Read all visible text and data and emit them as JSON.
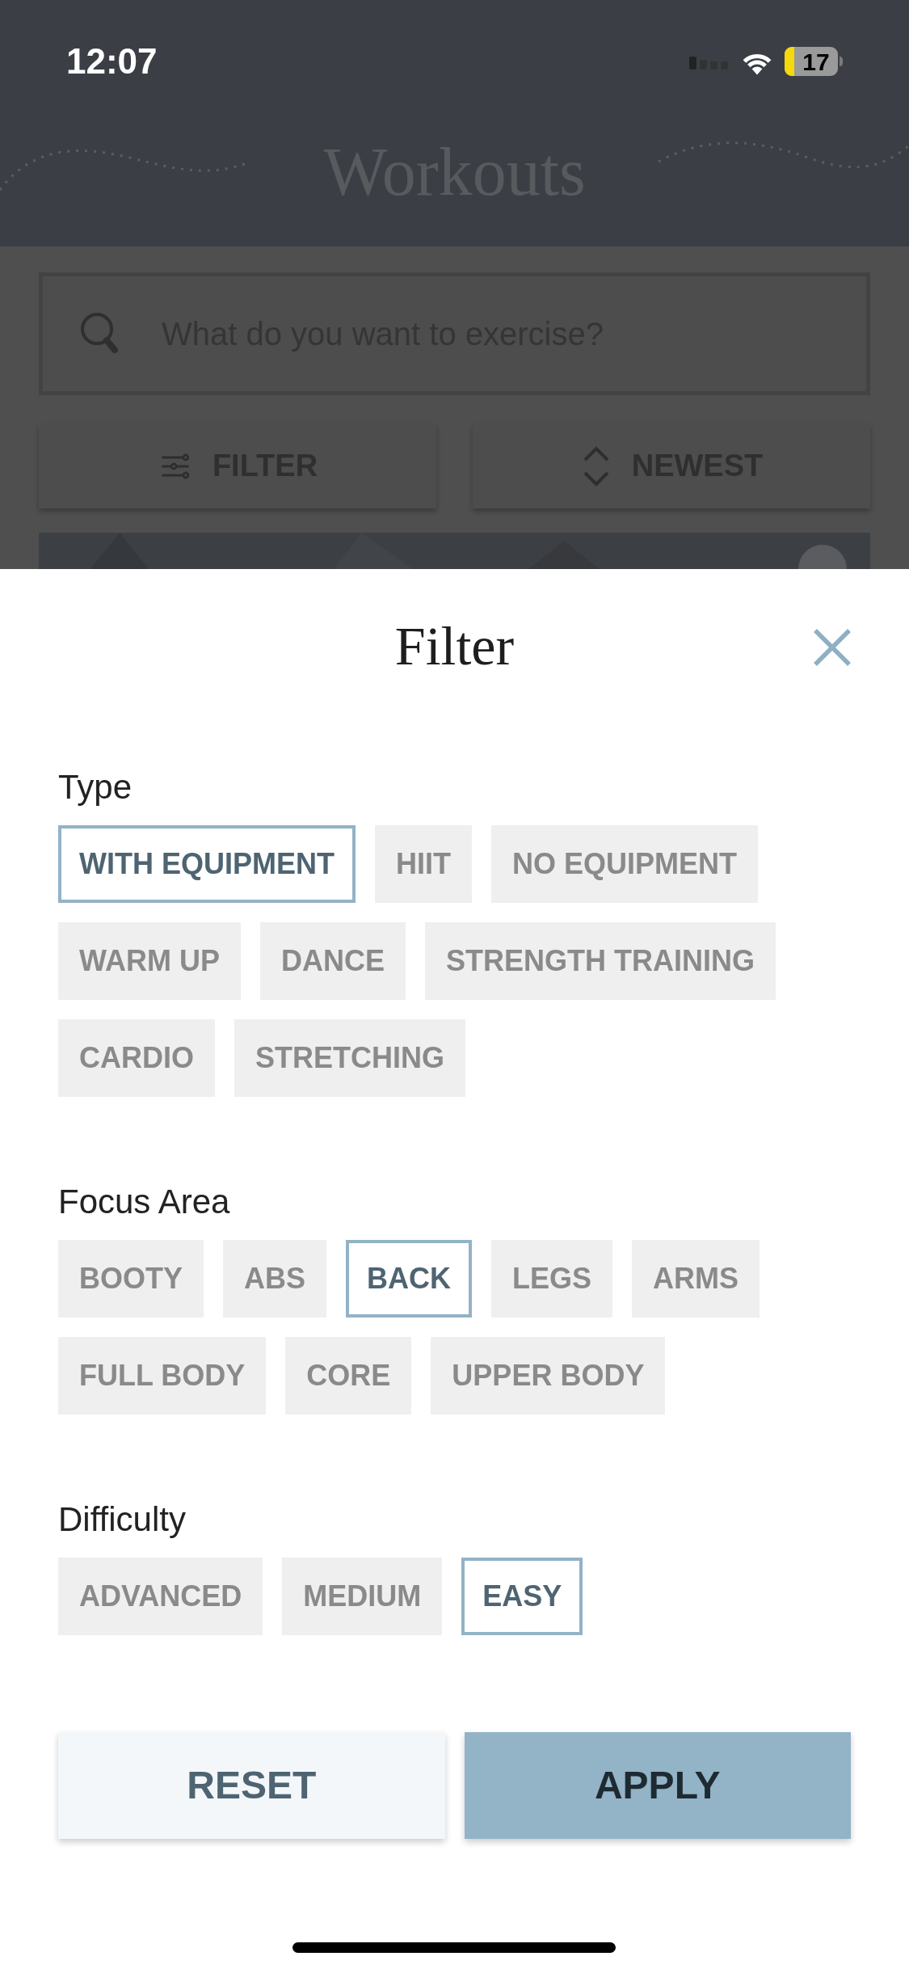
{
  "status_bar": {
    "time": "12:07",
    "battery": "17"
  },
  "header": {
    "title": "Workouts"
  },
  "search": {
    "placeholder": "What do you want to exercise?"
  },
  "toolbar": [
    {
      "label": "FILTER",
      "kind": "filter"
    },
    {
      "label": "NEWEST",
      "kind": "sort"
    }
  ],
  "sheet": {
    "title": "Filter",
    "sections": [
      {
        "label": "Type",
        "options": [
          {
            "label": "WITH EQUIPMENT",
            "selected": true
          },
          {
            "label": "HIIT",
            "selected": false
          },
          {
            "label": "NO EQUIPMENT",
            "selected": false
          },
          {
            "label": "WARM UP",
            "selected": false
          },
          {
            "label": "DANCE",
            "selected": false
          },
          {
            "label": "STRENGTH TRAINING",
            "selected": false
          },
          {
            "label": "CARDIO",
            "selected": false
          },
          {
            "label": "STRETCHING",
            "selected": false
          }
        ]
      },
      {
        "label": "Focus Area",
        "options": [
          {
            "label": "BOOTY",
            "selected": false
          },
          {
            "label": "ABS",
            "selected": false
          },
          {
            "label": "BACK",
            "selected": true
          },
          {
            "label": "LEGS",
            "selected": false
          },
          {
            "label": "ARMS",
            "selected": false
          },
          {
            "label": "FULL BODY",
            "selected": false
          },
          {
            "label": "CORE",
            "selected": false
          },
          {
            "label": "UPPER BODY",
            "selected": false
          }
        ]
      },
      {
        "label": "Difficulty",
        "options": [
          {
            "label": "ADVANCED",
            "selected": false
          },
          {
            "label": "MEDIUM",
            "selected": false
          },
          {
            "label": "EASY",
            "selected": true
          }
        ]
      }
    ],
    "buttons": [
      {
        "label": "RESET",
        "kind": "secondary"
      },
      {
        "label": "APPLY",
        "kind": "primary"
      }
    ]
  }
}
